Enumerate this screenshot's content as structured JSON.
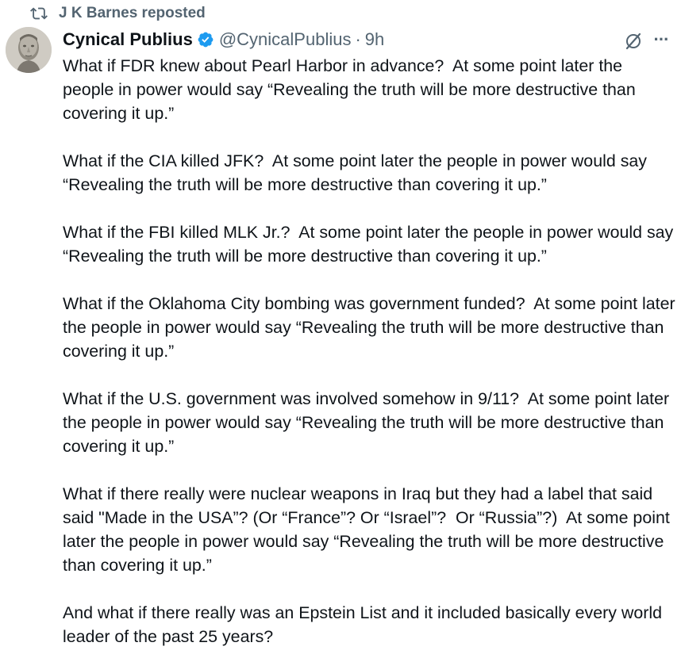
{
  "repost": {
    "icon": "repost-icon",
    "label": "J K Barnes reposted"
  },
  "author": {
    "display_name": "Cynical Publius",
    "verified": true,
    "handle": "@CynicalPublius",
    "separator": "·",
    "time": "9h"
  },
  "actions": {
    "grok_icon": "grok-icon",
    "more_label": "···"
  },
  "colors": {
    "text": "#0f1419",
    "muted": "#536471",
    "verified_blue": "#1d9bf0"
  },
  "body": {
    "paragraphs": [
      "What if FDR knew about Pearl Harbor in advance?  At some point later the people in power would say “Revealing the truth will be more destructive than covering it up.”",
      "What if the CIA killed JFK?  At some point later the people in power would say “Revealing the truth will be more destructive than covering it up.”",
      "What if the FBI killed MLK Jr.?  At some point later the people in power would say “Revealing the truth will be more destructive than covering it up.”",
      "What if the Oklahoma City bombing was government funded?  At some point later the people in power would say “Revealing the truth will be more destructive than covering it up.”",
      "What if the U.S. government was involved somehow in 9/11?  At some point later the people in power would say “Revealing the truth will be more destructive than covering it up.”",
      "What if there really were nuclear weapons in Iraq but they had a label that said  said \"Made in the USA”? (Or “France”? Or “Israel”?  Or “Russia”?)  At some point later the people in power would say “Revealing the truth will be more destructive than covering it up.”",
      "And what if there really was an Epstein List and it included basically every world leader of the past 25 years?"
    ]
  }
}
